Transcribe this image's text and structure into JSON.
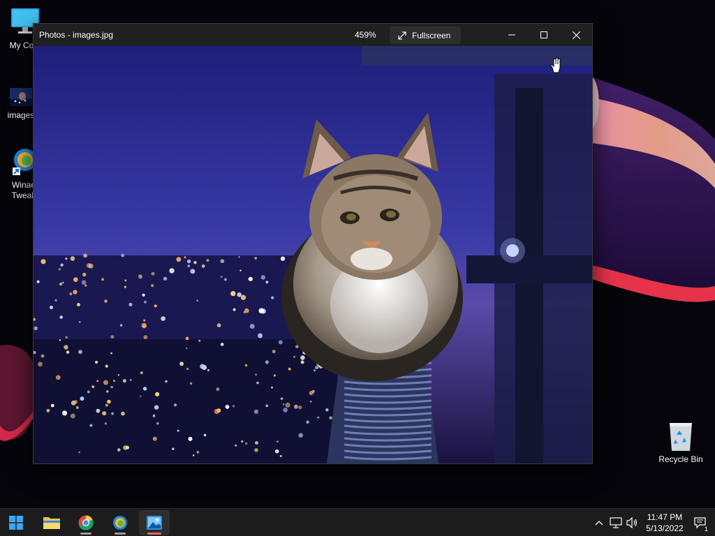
{
  "desktop": {
    "icons": [
      {
        "label": "My Com",
        "icon": "computer-icon"
      },
      {
        "label": "images",
        "icon": "image-file-icon"
      },
      {
        "label": "Winae",
        "label2": "Tweak",
        "icon": "winaero-tweaker-icon"
      },
      {
        "label": "Recycle Bin",
        "icon": "recycle-bin-icon"
      }
    ]
  },
  "window": {
    "title": "Photos - images.jpg",
    "zoom": "459%",
    "fullscreen_label": "Fullscreen",
    "controls": [
      "minimize-icon",
      "maximize-icon",
      "close-icon"
    ],
    "image": {
      "subject": "cat",
      "cursor": "hand-cursor-icon"
    }
  },
  "taskbar": {
    "buttons": [
      {
        "name": "start-button",
        "icon": "windows-logo-icon"
      },
      {
        "name": "file-explorer-button",
        "icon": "folder-icon"
      },
      {
        "name": "chrome-button",
        "icon": "chrome-icon"
      },
      {
        "name": "winaero-button",
        "icon": "winaero-tweaker-icon"
      },
      {
        "name": "photos-button",
        "icon": "photos-icon",
        "active": true
      }
    ],
    "tray": {
      "icons": [
        "chevron-up-icon",
        "network-icon",
        "volume-icon"
      ],
      "time": "11:47 PM",
      "date": "5/13/2022",
      "notifications": "1"
    }
  },
  "colors": {
    "taskbar_bg": "#1c1c1c",
    "titlebar_bg": "#202020",
    "active_indicator": "#d96a5c",
    "sky": "#2a2a8a"
  }
}
